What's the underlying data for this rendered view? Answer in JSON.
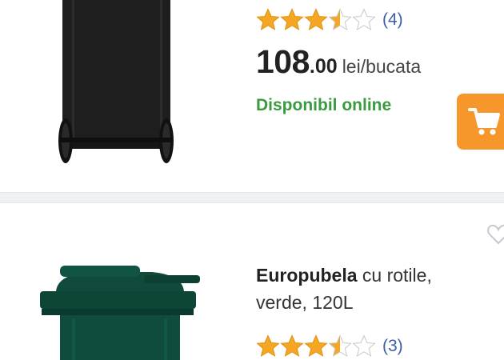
{
  "products": [
    {
      "rating_count": "(4)",
      "rating": 3.5,
      "price_int": "108",
      "price_dec": ".00",
      "price_unit": "lei/bucata",
      "availability": "Disponibil online",
      "cart_icon": "shopping-cart-icon"
    },
    {
      "title_bold": "Europubela",
      "title_rest": " cu rotile, verde, 120L",
      "rating_count": "(3)",
      "rating": 3.5,
      "fav_icon": "heart-outline-icon"
    }
  ],
  "colors": {
    "star_fill": "#f5a623",
    "accent_orange": "#f7962a",
    "availability_green": "#3a9a40",
    "rating_count_blue": "#3a5fa8"
  }
}
